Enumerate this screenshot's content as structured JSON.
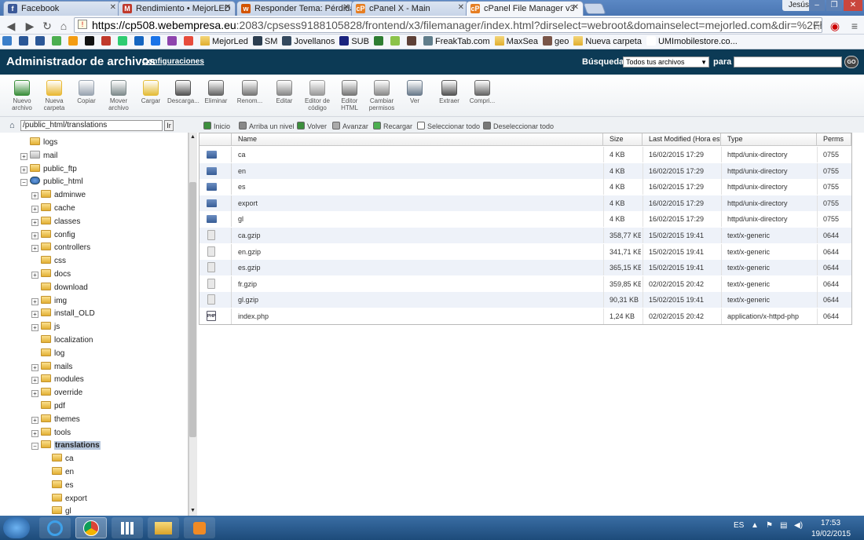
{
  "browser": {
    "tabs": [
      {
        "title": "Facebook",
        "color": "#3b5998",
        "fav": "f"
      },
      {
        "title": "Rendimiento • MejorLED",
        "color": "#c0392b",
        "fav": "M"
      },
      {
        "title": "Responder Tema: Pérdida",
        "color": "#d35400",
        "fav": "w"
      },
      {
        "title": "cPanel X - Main",
        "color": "#e67e22",
        "fav": "cP"
      },
      {
        "title": "cPanel File Manager v3",
        "color": "#e67e22",
        "fav": "cP",
        "active": true
      }
    ],
    "user": "Jesús",
    "url_host": "https://cp508.webempresa.eu",
    "url_rest": ":2083/cpsess9188105828/frontend/x3/filemanager/index.html?dirselect=webroot&domainselect=mejorled.com&dir=%2Fhome%2Fmejorl",
    "bookmarks": [
      {
        "label": "",
        "color": "#3b7ec9"
      },
      {
        "label": "",
        "color": "#2b5797"
      },
      {
        "label": "",
        "color": "#2b5797"
      },
      {
        "label": "",
        "color": "#4caf50"
      },
      {
        "label": "",
        "color": "#f39c12"
      },
      {
        "label": "",
        "color": "#111111"
      },
      {
        "label": "",
        "color": "#c0392b"
      },
      {
        "label": "",
        "color": "#2ecc71"
      },
      {
        "label": "",
        "color": "#1565c0"
      },
      {
        "label": "",
        "color": "#1a73e8"
      },
      {
        "label": "",
        "color": "#8e44ad"
      },
      {
        "label": "",
        "color": "#e74c3c"
      },
      {
        "label": "MejorLed",
        "color": "folder"
      },
      {
        "label": "SM",
        "color": "#2c3e50"
      },
      {
        "label": "Jovellanos",
        "color": "#34495e"
      },
      {
        "label": "SUB",
        "color": "#1a237e"
      },
      {
        "label": "",
        "color": "#2e7d32"
      },
      {
        "label": "",
        "color": "#8bc34a"
      },
      {
        "label": "",
        "color": "#5d4037"
      },
      {
        "label": "FreakTab.com",
        "color": "#607d8b"
      },
      {
        "label": "MaxSea",
        "color": "folder"
      },
      {
        "label": "geo",
        "color": "#795548"
      },
      {
        "label": "Nueva carpeta",
        "color": "folder"
      },
      {
        "label": "UMImobilestore.co...",
        "color": "#ffffff"
      }
    ]
  },
  "app": {
    "title": "Administrador de archivos",
    "config_link": "Configuraciones",
    "search_label": "Búsqueda",
    "search_select": "Todos tus archivos",
    "para_label": "para",
    "go_label": "GO"
  },
  "tools": [
    {
      "l1": "Nuevo",
      "l2": "archivo",
      "color": "#3c8f3c"
    },
    {
      "l1": "Nueva",
      "l2": "carpeta",
      "color": "#e9b936"
    },
    {
      "l1": "Copiar",
      "l2": "",
      "color": "#9aa5b1"
    },
    {
      "l1": "Mover",
      "l2": "archivo",
      "color": "#7f8c8d"
    },
    {
      "l1": "Cargar",
      "l2": "",
      "color": "#e4bd3a"
    },
    {
      "l1": "Descarga...",
      "l2": "",
      "color": "#555555"
    },
    {
      "l1": "Eliminar",
      "l2": "",
      "color": "#666666"
    },
    {
      "l1": "Renom...",
      "l2": "",
      "color": "#777777"
    },
    {
      "l1": "Editar",
      "l2": "",
      "color": "#888888"
    },
    {
      "l1": "Editor de",
      "l2": "código",
      "color": "#999999"
    },
    {
      "l1": "Editor",
      "l2": "HTML",
      "color": "#777777"
    },
    {
      "l1": "Cambiar",
      "l2": "permisos",
      "color": "#8a8a8a"
    },
    {
      "l1": "Ver",
      "l2": "",
      "color": "#6b7b8c"
    },
    {
      "l1": "Extraer",
      "l2": "",
      "color": "#555555"
    },
    {
      "l1": "Compri...",
      "l2": "",
      "color": "#666666"
    }
  ],
  "path_value": "/public_html/translations",
  "ir_label": "Ir",
  "actions": [
    {
      "label": "Inicio",
      "color": "#3c8f3c"
    },
    {
      "label": "Arriba un nivel",
      "color": "#888888"
    },
    {
      "label": "Volver",
      "color": "#3c8f3c"
    },
    {
      "label": "Avanzar",
      "color": "#aaaaaa"
    },
    {
      "label": "Recargar",
      "color": "#4caf50"
    },
    {
      "label": "Seleccionar todo",
      "color": "#ffffff"
    },
    {
      "label": "Deseleccionar todo",
      "color": "#777777"
    }
  ],
  "tree": [
    {
      "label": "logs",
      "indent": 0,
      "pm": ""
    },
    {
      "label": "mail",
      "indent": 0,
      "pm": "+",
      "kind": "mail"
    },
    {
      "label": "public_ftp",
      "indent": 0,
      "pm": "+",
      "kind": "ftp"
    },
    {
      "label": "public_html",
      "indent": 0,
      "pm": "−",
      "kind": "web"
    },
    {
      "label": "adminwe",
      "indent": 1,
      "pm": "+"
    },
    {
      "label": "cache",
      "indent": 1,
      "pm": "+"
    },
    {
      "label": "classes",
      "indent": 1,
      "pm": "+"
    },
    {
      "label": "config",
      "indent": 1,
      "pm": "+"
    },
    {
      "label": "controllers",
      "indent": 1,
      "pm": "+"
    },
    {
      "label": "css",
      "indent": 1,
      "pm": ""
    },
    {
      "label": "docs",
      "indent": 1,
      "pm": "+"
    },
    {
      "label": "download",
      "indent": 1,
      "pm": ""
    },
    {
      "label": "img",
      "indent": 1,
      "pm": "+"
    },
    {
      "label": "install_OLD",
      "indent": 1,
      "pm": "+"
    },
    {
      "label": "js",
      "indent": 1,
      "pm": "+"
    },
    {
      "label": "localization",
      "indent": 1,
      "pm": ""
    },
    {
      "label": "log",
      "indent": 1,
      "pm": ""
    },
    {
      "label": "mails",
      "indent": 1,
      "pm": "+"
    },
    {
      "label": "modules",
      "indent": 1,
      "pm": "+"
    },
    {
      "label": "override",
      "indent": 1,
      "pm": "+"
    },
    {
      "label": "pdf",
      "indent": 1,
      "pm": ""
    },
    {
      "label": "themes",
      "indent": 1,
      "pm": "+"
    },
    {
      "label": "tools",
      "indent": 1,
      "pm": "+"
    },
    {
      "label": "translations",
      "indent": 1,
      "pm": "−",
      "selected": true
    },
    {
      "label": "ca",
      "indent": 2,
      "pm": ""
    },
    {
      "label": "en",
      "indent": 2,
      "pm": ""
    },
    {
      "label": "es",
      "indent": 2,
      "pm": ""
    },
    {
      "label": "export",
      "indent": 2,
      "pm": ""
    },
    {
      "label": "gl",
      "indent": 2,
      "pm": ""
    }
  ],
  "columns": [
    "Name",
    "Size",
    "Last Modified (Hora está",
    "Type",
    "Perms"
  ],
  "files": [
    {
      "name": "ca",
      "size": "4 KB",
      "modified": "16/02/2015 17:29",
      "type": "httpd/unix-directory",
      "perms": "0755",
      "kind": "dir"
    },
    {
      "name": "en",
      "size": "4 KB",
      "modified": "16/02/2015 17:29",
      "type": "httpd/unix-directory",
      "perms": "0755",
      "kind": "dir"
    },
    {
      "name": "es",
      "size": "4 KB",
      "modified": "16/02/2015 17:29",
      "type": "httpd/unix-directory",
      "perms": "0755",
      "kind": "dir"
    },
    {
      "name": "export",
      "size": "4 KB",
      "modified": "16/02/2015 17:29",
      "type": "httpd/unix-directory",
      "perms": "0755",
      "kind": "dir"
    },
    {
      "name": "gl",
      "size": "4 KB",
      "modified": "16/02/2015 17:29",
      "type": "httpd/unix-directory",
      "perms": "0755",
      "kind": "dir"
    },
    {
      "name": "ca.gzip",
      "size": "358,77 KB",
      "modified": "15/02/2015 19:41",
      "type": "text/x-generic",
      "perms": "0644",
      "kind": "gz"
    },
    {
      "name": "en.gzip",
      "size": "341,71 KB",
      "modified": "15/02/2015 19:41",
      "type": "text/x-generic",
      "perms": "0644",
      "kind": "gz"
    },
    {
      "name": "es.gzip",
      "size": "365,15 KB",
      "modified": "15/02/2015 19:41",
      "type": "text/x-generic",
      "perms": "0644",
      "kind": "gz"
    },
    {
      "name": "fr.gzip",
      "size": "359,85 KB",
      "modified": "02/02/2015 20:42",
      "type": "text/x-generic",
      "perms": "0644",
      "kind": "gz"
    },
    {
      "name": "gl.gzip",
      "size": "90,31 KB",
      "modified": "15/02/2015 19:41",
      "type": "text/x-generic",
      "perms": "0644",
      "kind": "gz"
    },
    {
      "name": "index.php",
      "size": "1,24 KB",
      "modified": "02/02/2015 20:42",
      "type": "application/x-httpd-php",
      "perms": "0644",
      "kind": "php"
    }
  ],
  "taskbar": {
    "lang": "ES",
    "time": "17:53",
    "date": "19/02/2015"
  }
}
